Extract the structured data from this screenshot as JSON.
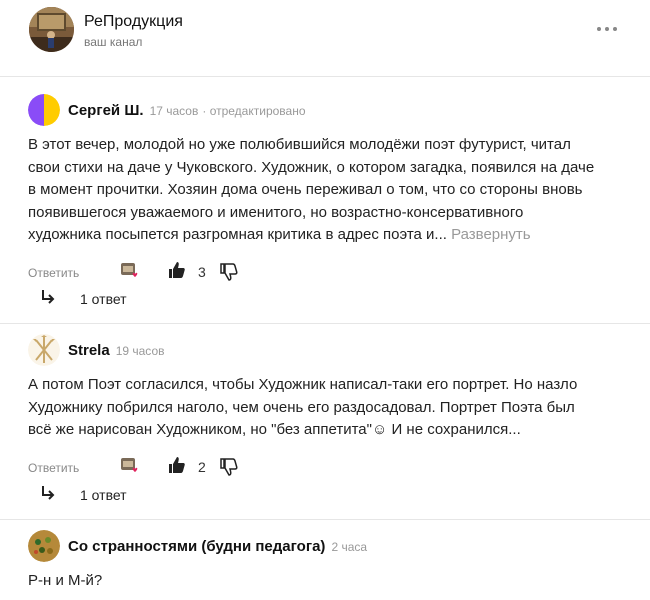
{
  "channel": {
    "name": "РеПродукция",
    "subtitle": "ваш канал"
  },
  "comments": [
    {
      "author": "Сергей Ш.",
      "time": "17 часов",
      "edited": "· отредактировано",
      "lines": [
        "В этот вечер, молодой но уже полюбившийся молодёжи поэт футурист, читал",
        "свои стихи на даче у Чуковского. Художник, о котором загадка, появился на даче",
        "в момент прочитки. Хозяин дома очень переживал о том, что со стороны вновь",
        "появившегося уважаемого и именитого, но возрастно-консервативного",
        "художника посыпется разгромная критика в адрес поэта и..."
      ],
      "expand": "Развернуть",
      "reply_label": "Ответить",
      "likes": "3",
      "replies": "1 ответ",
      "avatar_colors": [
        "#ffcc00",
        "#8844ff"
      ]
    },
    {
      "author": "Strela",
      "time": "19 часов",
      "lines": [
        "А потом Поэт согласился, чтобы Художник написал-таки его портрет. Но назло",
        "Художнику побрился наголо, чем очень его раздосадовал. Портрет Поэта был",
        "всё же нарисован Художником, но \"без аппетита\"☺ И не сохранился..."
      ],
      "reply_label": "Ответить",
      "likes": "2",
      "replies": "1 ответ"
    },
    {
      "author": "Со странностями (будни педагога)",
      "time": "2 часа",
      "lines": [
        "Р-н и М-й?"
      ]
    }
  ],
  "colors": {
    "accent": "#ffcc00",
    "muted": "#999999",
    "heart": "#e0245e"
  }
}
